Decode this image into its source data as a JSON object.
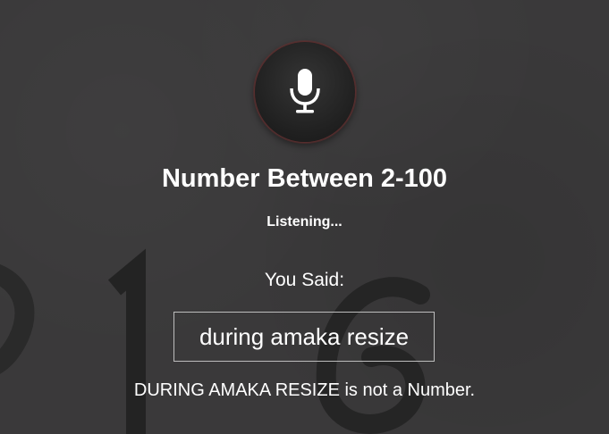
{
  "page": {
    "background_color": "#3a393a",
    "accent_color": "#5a2d2d"
  },
  "mic": {
    "icon": "microphone-icon"
  },
  "prompt": {
    "title": "Number Between 2-100",
    "status": "Listening...",
    "you_said_label": "You Said:",
    "transcript": "during amaka resize",
    "error_message": "DURING AMAKA RESIZE is not a Number."
  }
}
